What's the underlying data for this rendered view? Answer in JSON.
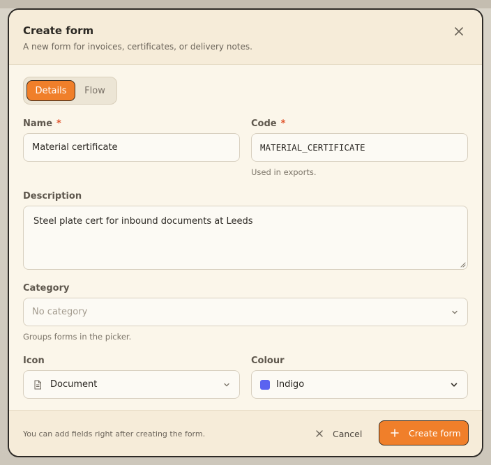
{
  "modal": {
    "title": "Create form",
    "subtitle": "A new form for invoices, certificates, or delivery notes."
  },
  "tabs": [
    {
      "label": "Details",
      "active": true
    },
    {
      "label": "Flow",
      "active": false
    }
  ],
  "form": {
    "name": {
      "label": "Name",
      "required_mark": "*",
      "value": "Material certificate"
    },
    "code": {
      "label": "Code",
      "required_mark": "*",
      "value": "MATERIAL_CERTIFICATE",
      "hint": "Used in exports."
    },
    "description": {
      "label": "Description",
      "value": "Steel plate cert for inbound documents at Leeds"
    },
    "category": {
      "label": "Category",
      "placeholder": "No category",
      "hint": "Groups forms in the picker."
    },
    "icon": {
      "label": "Icon",
      "value": "Document",
      "icon_name": "document-icon"
    },
    "colour": {
      "label": "Colour",
      "value": "Indigo",
      "swatch": "#5b63f0"
    }
  },
  "footer": {
    "note": "You can add fields right after creating the form.",
    "cancel_label": "Cancel",
    "create_label": "Create form"
  },
  "colors": {
    "accent": "#f07f2a",
    "required": "#e0522a"
  }
}
